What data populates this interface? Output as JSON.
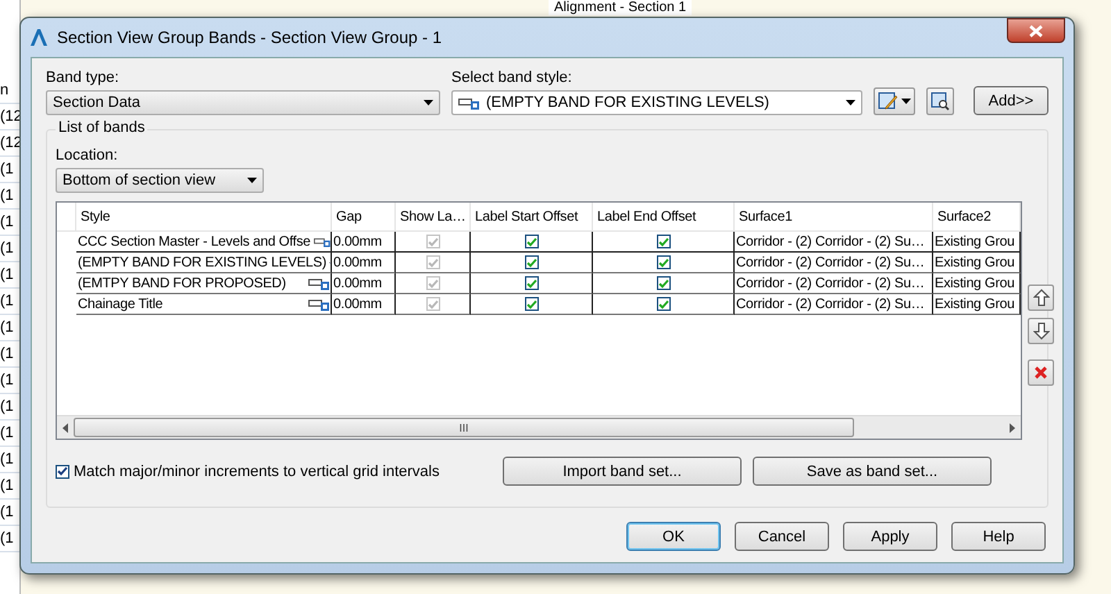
{
  "background": {
    "header_text": "Alignment - Section 1",
    "list_items": [
      "n",
      "(12",
      "(12",
      "(1",
      "(1",
      "(1",
      "(1",
      "(1",
      "(1",
      "(1",
      "(1",
      "(1",
      "(1",
      "(1",
      "(1",
      "(1",
      "(1",
      "(1"
    ]
  },
  "window": {
    "title": "Section View Group Bands - Section View Group - 1"
  },
  "band_type": {
    "label": "Band type:",
    "value": "Section Data"
  },
  "band_style": {
    "label": "Select band style:",
    "value": "(EMPTY BAND FOR EXISTING LEVELS)"
  },
  "add_button": "Add>>",
  "list_of_bands": {
    "title": "List of bands",
    "location": {
      "label": "Location:",
      "value": "Bottom of section view"
    },
    "table": {
      "columns": [
        "Style",
        "Gap",
        "Show La…",
        "Label Start Offset",
        "Label End Offset",
        "Surface1",
        "Surface2"
      ],
      "rows": [
        {
          "style": "CCC Section Master - Levels and Offse",
          "gap": "0.00mm",
          "show_labels": true,
          "show_labels_disabled": true,
          "label_start_offset": true,
          "label_end_offset": true,
          "surface1": "Corridor - (2) Corridor - (2) Su…",
          "surface2": "Existing Grou"
        },
        {
          "style": "(EMPTY BAND FOR EXISTING LEVELS)",
          "gap": "0.00mm",
          "show_labels": true,
          "show_labels_disabled": true,
          "label_start_offset": true,
          "label_end_offset": true,
          "surface1": "Corridor - (2) Corridor - (2) Su…",
          "surface2": "Existing Grou"
        },
        {
          "style": "(EMTPY BAND FOR PROPOSED)",
          "gap": "0.00mm",
          "show_labels": true,
          "show_labels_disabled": true,
          "label_start_offset": true,
          "label_end_offset": true,
          "surface1": "Corridor - (2) Corridor - (2) Su…",
          "surface2": "Existing Grou"
        },
        {
          "style": "Chainage Title",
          "gap": "0.00mm",
          "show_labels": true,
          "show_labels_disabled": true,
          "label_start_offset": true,
          "label_end_offset": true,
          "surface1": "Corridor - (2) Corridor - (2) Su…",
          "surface2": "Existing Grou"
        }
      ],
      "scroll_grip": "III"
    },
    "match_increments": {
      "label": "Match major/minor increments to vertical grid intervals",
      "checked": true
    },
    "band_set_buttons": [
      "Import band set...",
      "Save as band set..."
    ]
  },
  "buttons": [
    {
      "label": "OK",
      "default": true
    },
    {
      "label": "Cancel",
      "default": false
    },
    {
      "label": "Apply",
      "default": false
    },
    {
      "label": "Help",
      "default": false
    }
  ]
}
